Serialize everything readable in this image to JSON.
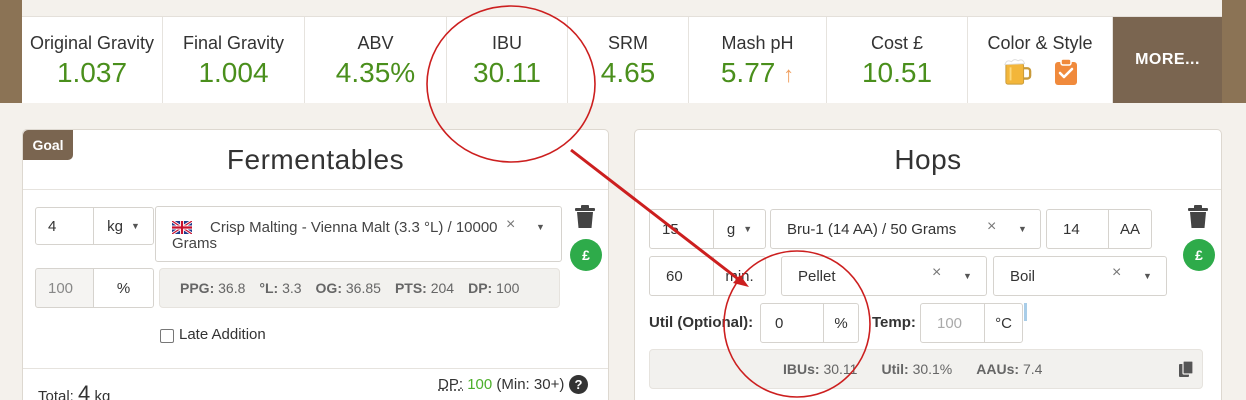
{
  "stats": [
    {
      "label": "Original Gravity",
      "value": "1.037"
    },
    {
      "label": "Final Gravity",
      "value": "1.004"
    },
    {
      "label": "ABV",
      "value": "4.35%"
    },
    {
      "label": "IBU",
      "value": "30.11"
    },
    {
      "label": "SRM",
      "value": "4.65"
    },
    {
      "label": "Mash pH",
      "value": "5.77",
      "trend": "↑"
    },
    {
      "label": "Cost £",
      "value": "10.51"
    },
    {
      "label": "Color & Style",
      "icons": [
        "beer-mug-icon",
        "clipboard-check-icon"
      ]
    }
  ],
  "more_label": "MORE...",
  "fermentables": {
    "badge": "Goal",
    "title": "Fermentables",
    "amount": "4",
    "unit": "kg",
    "grain_line1": "Crisp Malting - Vienna Malt (3.3 °L) / 10000",
    "grain_line2": "Grams",
    "percent_value": "100",
    "percent_unit": "%",
    "stats": [
      {
        "key": "PPG:",
        "val": "36.8"
      },
      {
        "key": "°L:",
        "val": "3.3"
      },
      {
        "key": "OG:",
        "val": "36.85"
      },
      {
        "key": "PTS:",
        "val": "204"
      },
      {
        "key": "DP:",
        "val": "100"
      }
    ],
    "late_addition": "Late Addition",
    "total_label": "Total:",
    "total_value": "4",
    "total_unit": "kg",
    "dp_label": "DP:",
    "dp_value": "100",
    "dp_min": "(Min: 30+)",
    "pound": "£"
  },
  "hops": {
    "title": "Hops",
    "amount": "15",
    "unit": "g",
    "variety": "Bru-1 (14 AA) / 50 Grams",
    "aa_value": "14",
    "aa_label": "AA",
    "time": "60",
    "time_unit": "min.",
    "form": "Pellet",
    "use": "Boil",
    "util_label": "Util (Optional):",
    "util_value": "0",
    "util_unit": "%",
    "temp_label": "Temp:",
    "temp_placeholder": "100",
    "temp_unit": "°C",
    "ibus_label": "IBUs:",
    "ibus_value": "30.11",
    "util_stat_label": "Util:",
    "util_stat_value": "30.1%",
    "aaus_label": "AAUs:",
    "aaus_value": "7.4",
    "pound": "£"
  },
  "colors": {
    "accent_green": "#4a8f1c",
    "brown": "#7a6550",
    "annotation_red": "#cc1f1f"
  }
}
